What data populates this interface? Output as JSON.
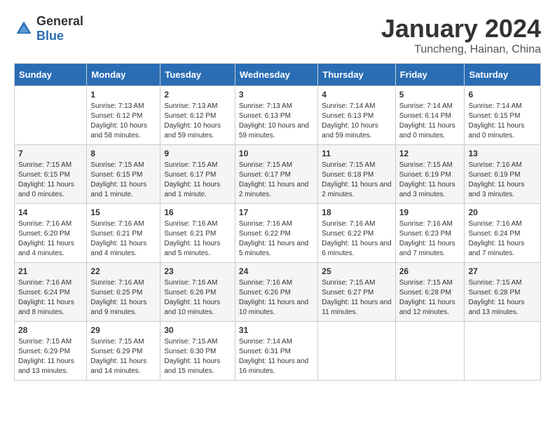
{
  "header": {
    "logo_general": "General",
    "logo_blue": "Blue",
    "month_year": "January 2024",
    "location": "Tuncheng, Hainan, China"
  },
  "days_of_week": [
    "Sunday",
    "Monday",
    "Tuesday",
    "Wednesday",
    "Thursday",
    "Friday",
    "Saturday"
  ],
  "weeks": [
    [
      {
        "day": "",
        "sunrise": "",
        "sunset": "",
        "daylight": ""
      },
      {
        "day": "1",
        "sunrise": "Sunrise: 7:13 AM",
        "sunset": "Sunset: 6:12 PM",
        "daylight": "Daylight: 10 hours and 58 minutes."
      },
      {
        "day": "2",
        "sunrise": "Sunrise: 7:13 AM",
        "sunset": "Sunset: 6:12 PM",
        "daylight": "Daylight: 10 hours and 59 minutes."
      },
      {
        "day": "3",
        "sunrise": "Sunrise: 7:13 AM",
        "sunset": "Sunset: 6:13 PM",
        "daylight": "Daylight: 10 hours and 59 minutes."
      },
      {
        "day": "4",
        "sunrise": "Sunrise: 7:14 AM",
        "sunset": "Sunset: 6:13 PM",
        "daylight": "Daylight: 10 hours and 59 minutes."
      },
      {
        "day": "5",
        "sunrise": "Sunrise: 7:14 AM",
        "sunset": "Sunset: 6:14 PM",
        "daylight": "Daylight: 11 hours and 0 minutes."
      },
      {
        "day": "6",
        "sunrise": "Sunrise: 7:14 AM",
        "sunset": "Sunset: 6:15 PM",
        "daylight": "Daylight: 11 hours and 0 minutes."
      }
    ],
    [
      {
        "day": "7",
        "sunrise": "Sunrise: 7:15 AM",
        "sunset": "Sunset: 6:15 PM",
        "daylight": "Daylight: 11 hours and 0 minutes."
      },
      {
        "day": "8",
        "sunrise": "Sunrise: 7:15 AM",
        "sunset": "Sunset: 6:15 PM",
        "daylight": "Daylight: 11 hours and 1 minute."
      },
      {
        "day": "9",
        "sunrise": "Sunrise: 7:15 AM",
        "sunset": "Sunset: 6:17 PM",
        "daylight": "Daylight: 11 hours and 1 minute."
      },
      {
        "day": "10",
        "sunrise": "Sunrise: 7:15 AM",
        "sunset": "Sunset: 6:17 PM",
        "daylight": "Daylight: 11 hours and 2 minutes."
      },
      {
        "day": "11",
        "sunrise": "Sunrise: 7:15 AM",
        "sunset": "Sunset: 6:18 PM",
        "daylight": "Daylight: 11 hours and 2 minutes."
      },
      {
        "day": "12",
        "sunrise": "Sunrise: 7:15 AM",
        "sunset": "Sunset: 6:19 PM",
        "daylight": "Daylight: 11 hours and 3 minutes."
      },
      {
        "day": "13",
        "sunrise": "Sunrise: 7:16 AM",
        "sunset": "Sunset: 6:19 PM",
        "daylight": "Daylight: 11 hours and 3 minutes."
      }
    ],
    [
      {
        "day": "14",
        "sunrise": "Sunrise: 7:16 AM",
        "sunset": "Sunset: 6:20 PM",
        "daylight": "Daylight: 11 hours and 4 minutes."
      },
      {
        "day": "15",
        "sunrise": "Sunrise: 7:16 AM",
        "sunset": "Sunset: 6:21 PM",
        "daylight": "Daylight: 11 hours and 4 minutes."
      },
      {
        "day": "16",
        "sunrise": "Sunrise: 7:16 AM",
        "sunset": "Sunset: 6:21 PM",
        "daylight": "Daylight: 11 hours and 5 minutes."
      },
      {
        "day": "17",
        "sunrise": "Sunrise: 7:16 AM",
        "sunset": "Sunset: 6:22 PM",
        "daylight": "Daylight: 11 hours and 5 minutes."
      },
      {
        "day": "18",
        "sunrise": "Sunrise: 7:16 AM",
        "sunset": "Sunset: 6:22 PM",
        "daylight": "Daylight: 11 hours and 6 minutes."
      },
      {
        "day": "19",
        "sunrise": "Sunrise: 7:16 AM",
        "sunset": "Sunset: 6:23 PM",
        "daylight": "Daylight: 11 hours and 7 minutes."
      },
      {
        "day": "20",
        "sunrise": "Sunrise: 7:16 AM",
        "sunset": "Sunset: 6:24 PM",
        "daylight": "Daylight: 11 hours and 7 minutes."
      }
    ],
    [
      {
        "day": "21",
        "sunrise": "Sunrise: 7:16 AM",
        "sunset": "Sunset: 6:24 PM",
        "daylight": "Daylight: 11 hours and 8 minutes."
      },
      {
        "day": "22",
        "sunrise": "Sunrise: 7:16 AM",
        "sunset": "Sunset: 6:25 PM",
        "daylight": "Daylight: 11 hours and 9 minutes."
      },
      {
        "day": "23",
        "sunrise": "Sunrise: 7:16 AM",
        "sunset": "Sunset: 6:26 PM",
        "daylight": "Daylight: 11 hours and 10 minutes."
      },
      {
        "day": "24",
        "sunrise": "Sunrise: 7:16 AM",
        "sunset": "Sunset: 6:26 PM",
        "daylight": "Daylight: 11 hours and 10 minutes."
      },
      {
        "day": "25",
        "sunrise": "Sunrise: 7:15 AM",
        "sunset": "Sunset: 6:27 PM",
        "daylight": "Daylight: 11 hours and 11 minutes."
      },
      {
        "day": "26",
        "sunrise": "Sunrise: 7:15 AM",
        "sunset": "Sunset: 6:28 PM",
        "daylight": "Daylight: 11 hours and 12 minutes."
      },
      {
        "day": "27",
        "sunrise": "Sunrise: 7:15 AM",
        "sunset": "Sunset: 6:28 PM",
        "daylight": "Daylight: 11 hours and 13 minutes."
      }
    ],
    [
      {
        "day": "28",
        "sunrise": "Sunrise: 7:15 AM",
        "sunset": "Sunset: 6:29 PM",
        "daylight": "Daylight: 11 hours and 13 minutes."
      },
      {
        "day": "29",
        "sunrise": "Sunrise: 7:15 AM",
        "sunset": "Sunset: 6:29 PM",
        "daylight": "Daylight: 11 hours and 14 minutes."
      },
      {
        "day": "30",
        "sunrise": "Sunrise: 7:15 AM",
        "sunset": "Sunset: 6:30 PM",
        "daylight": "Daylight: 11 hours and 15 minutes."
      },
      {
        "day": "31",
        "sunrise": "Sunrise: 7:14 AM",
        "sunset": "Sunset: 6:31 PM",
        "daylight": "Daylight: 11 hours and 16 minutes."
      },
      {
        "day": "",
        "sunrise": "",
        "sunset": "",
        "daylight": ""
      },
      {
        "day": "",
        "sunrise": "",
        "sunset": "",
        "daylight": ""
      },
      {
        "day": "",
        "sunrise": "",
        "sunset": "",
        "daylight": ""
      }
    ]
  ]
}
